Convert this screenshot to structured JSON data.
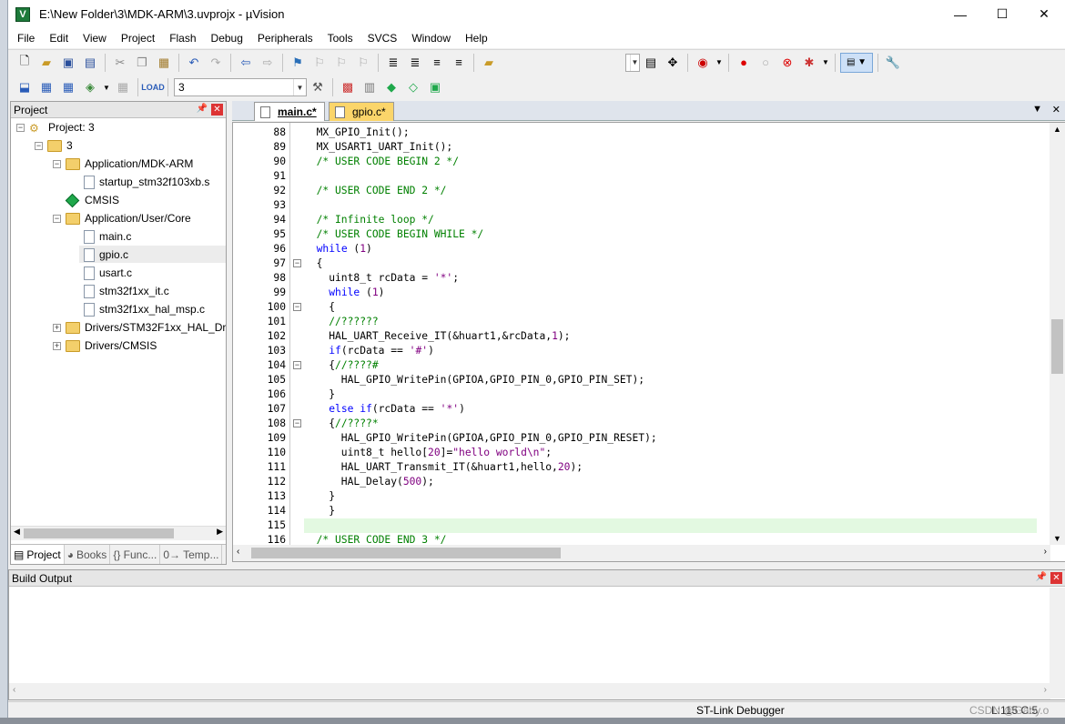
{
  "window": {
    "title": "E:\\New Folder\\3\\MDK-ARM\\3.uvprojx - µVision"
  },
  "menu": [
    "File",
    "Edit",
    "View",
    "Project",
    "Flash",
    "Debug",
    "Peripherals",
    "Tools",
    "SVCS",
    "Window",
    "Help"
  ],
  "toolbar2": {
    "target_value": "3"
  },
  "project_panel": {
    "title": "Project",
    "tree": [
      {
        "label": "Project: 3",
        "level": 0,
        "kind": "project",
        "expander": "−"
      },
      {
        "label": "3",
        "level": 1,
        "kind": "target",
        "expander": "−"
      },
      {
        "label": "Application/MDK-ARM",
        "level": 2,
        "kind": "folder",
        "expander": "−"
      },
      {
        "label": "startup_stm32f103xb.s",
        "level": 3,
        "kind": "file"
      },
      {
        "label": "CMSIS",
        "level": 2,
        "kind": "component"
      },
      {
        "label": "Application/User/Core",
        "level": 2,
        "kind": "folder",
        "expander": "−"
      },
      {
        "label": "main.c",
        "level": 3,
        "kind": "file",
        "selected": true
      },
      {
        "label": "gpio.c",
        "level": 3,
        "kind": "file"
      },
      {
        "label": "usart.c",
        "level": 3,
        "kind": "file"
      },
      {
        "label": "stm32f1xx_it.c",
        "level": 3,
        "kind": "file"
      },
      {
        "label": "stm32f1xx_hal_msp.c",
        "level": 3,
        "kind": "file"
      },
      {
        "label": "Drivers/STM32F1xx_HAL_Driv",
        "level": 2,
        "kind": "folder",
        "expander": "+"
      },
      {
        "label": "Drivers/CMSIS",
        "level": 2,
        "kind": "folder",
        "expander": "+"
      }
    ],
    "tabs": [
      "Project",
      "Books",
      "{} Func...",
      "0→ Temp..."
    ]
  },
  "editor": {
    "tabs": [
      "main.c*",
      "gpio.c*"
    ],
    "active_tab": "main.c*",
    "lines": [
      {
        "n": "88",
        "text": "  MX_GPIO_Init();",
        "cls": ""
      },
      {
        "n": "89",
        "text": "  MX_USART1_UART_Init();",
        "cls": ""
      },
      {
        "n": "90",
        "text": "  /* USER CODE BEGIN 2 */",
        "cls": "c-cm"
      },
      {
        "n": "91",
        "text": "",
        "cls": ""
      },
      {
        "n": "92",
        "text": "  /* USER CODE END 2 */",
        "cls": "c-cm"
      },
      {
        "n": "93",
        "text": "",
        "cls": ""
      },
      {
        "n": "94",
        "text": "  /* Infinite loop */",
        "cls": "c-cm"
      },
      {
        "n": "95",
        "text": "  /* USER CODE BEGIN WHILE */",
        "cls": "c-cm"
      },
      {
        "n": "96",
        "text": "  while (1)",
        "cls": "mix-while"
      },
      {
        "n": "97",
        "text": "  {",
        "cls": "",
        "fold": "−"
      },
      {
        "n": "98",
        "text": "    uint8_t rcData = '*';",
        "cls": "mix-char"
      },
      {
        "n": "99",
        "text": "    while (1)",
        "cls": "mix-while"
      },
      {
        "n": "100",
        "text": "    {",
        "cls": "",
        "fold": "−"
      },
      {
        "n": "101",
        "text": "    //??????",
        "cls": "c-cm"
      },
      {
        "n": "102",
        "text": "    HAL_UART_Receive_IT(&huart1,&rcData,1);",
        "cls": "mix-num1"
      },
      {
        "n": "103",
        "text": "    if(rcData == '#')",
        "cls": "mix-if"
      },
      {
        "n": "104",
        "text": "    {//????#",
        "cls": "mix-bracecm",
        "fold": "−"
      },
      {
        "n": "105",
        "text": "      HAL_GPIO_WritePin(GPIOA,GPIO_PIN_0,GPIO_PIN_SET);",
        "cls": ""
      },
      {
        "n": "106",
        "text": "    }",
        "cls": ""
      },
      {
        "n": "107",
        "text": "    else if(rcData == '*')",
        "cls": "mix-elseif"
      },
      {
        "n": "108",
        "text": "    {//????*",
        "cls": "mix-bracecm",
        "fold": "−"
      },
      {
        "n": "109",
        "text": "      HAL_GPIO_WritePin(GPIOA,GPIO_PIN_0,GPIO_PIN_RESET);",
        "cls": ""
      },
      {
        "n": "110",
        "text": "      uint8_t hello[20]=\"hello world\\n\";",
        "cls": "mix-hello"
      },
      {
        "n": "111",
        "text": "      HAL_UART_Transmit_IT(&huart1,hello,20);",
        "cls": "mix-num20"
      },
      {
        "n": "112",
        "text": "      HAL_Delay(500);",
        "cls": "mix-num500"
      },
      {
        "n": "113",
        "text": "    }",
        "cls": ""
      },
      {
        "n": "114",
        "text": "    }",
        "cls": ""
      },
      {
        "n": "115",
        "text": "",
        "cls": "",
        "highlight": true
      },
      {
        "n": "116",
        "text": "  /* USER CODE END 3 */",
        "cls": "c-cm"
      }
    ]
  },
  "build_output": {
    "title": "Build Output"
  },
  "status": {
    "debugger": "ST-Link Debugger",
    "watermark": "CSDN @Gaby.o",
    "left_cut": "L:115 C:5"
  }
}
